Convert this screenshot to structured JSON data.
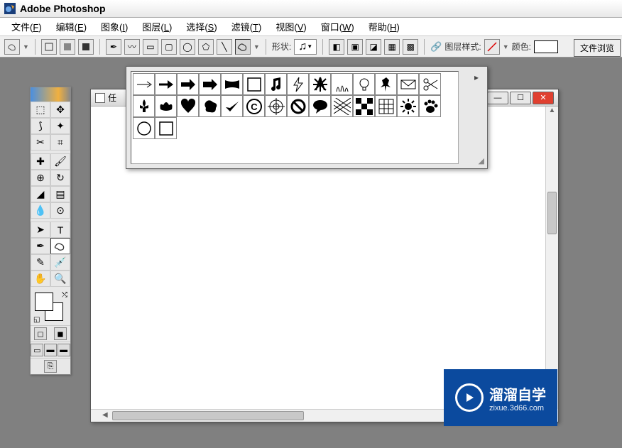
{
  "app": {
    "title": "Adobe Photoshop"
  },
  "menu": {
    "items": [
      {
        "label": "文件",
        "key": "F"
      },
      {
        "label": "编辑",
        "key": "E"
      },
      {
        "label": "图象",
        "key": "I"
      },
      {
        "label": "图层",
        "key": "L"
      },
      {
        "label": "选择",
        "key": "S"
      },
      {
        "label": "滤镜",
        "key": "T"
      },
      {
        "label": "视图",
        "key": "V"
      },
      {
        "label": "窗口",
        "key": "W"
      },
      {
        "label": "帮助",
        "key": "H"
      }
    ]
  },
  "options": {
    "shape_label": "形状:",
    "layer_style_label": "图层样式:",
    "color_label": "颜色:",
    "file_browse_label": "文件浏览"
  },
  "document": {
    "title": "任"
  },
  "shapes": [
    "arrow1",
    "arrow2",
    "arrow3",
    "arrow-block",
    "banner",
    "frame",
    "music-note",
    "lightning",
    "starburst",
    "grass",
    "bulb",
    "pushpin",
    "envelope",
    "scissors",
    "fleur",
    "crown",
    "heart",
    "blob",
    "checkmark",
    "copyright",
    "target",
    "no-entry",
    "speech",
    "pattern",
    "checker",
    "grid",
    "sun",
    "pawprint",
    "circle-outline",
    "square-outline"
  ],
  "watermark": {
    "main": "溜溜自学",
    "sub": "zixue.3d66.com"
  }
}
